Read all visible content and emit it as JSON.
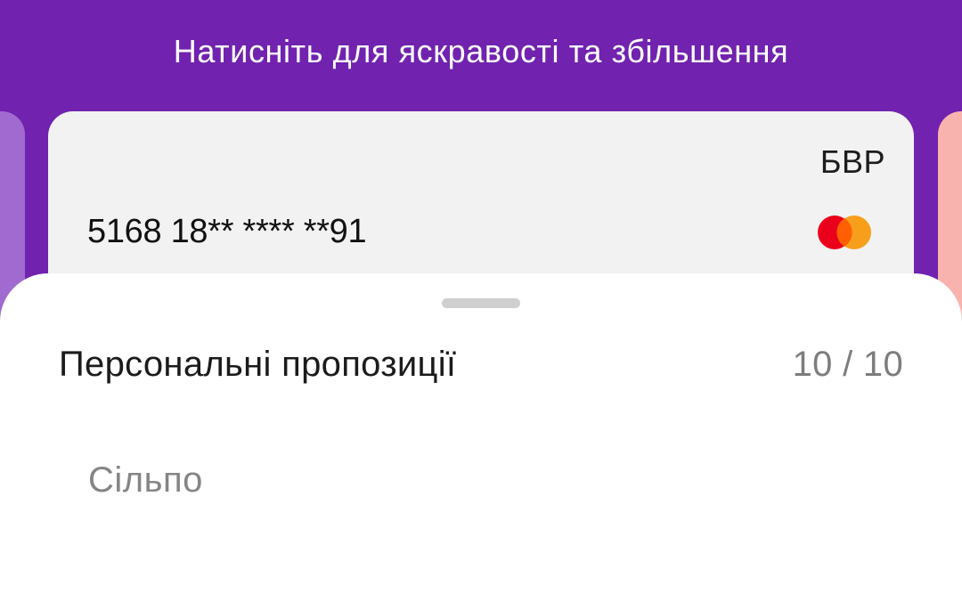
{
  "header": {
    "hint": "Натисніть для яскравості та збільшення"
  },
  "card": {
    "bank": "БВР",
    "number": "5168 18** **** **91",
    "network_icon": "mastercard-icon",
    "colors": {
      "mastercard_red": "#eb001b",
      "mastercard_orange": "#f79e1b"
    }
  },
  "sheet": {
    "title": "Персональні пропозиції",
    "counter": "10 / 10",
    "items": [
      {
        "label": "Сільпо"
      }
    ]
  },
  "colors": {
    "background": "#7122ae",
    "card": "#f2f2f2",
    "left_card": "#a06ad1",
    "right_card": "#f8b3ae"
  }
}
